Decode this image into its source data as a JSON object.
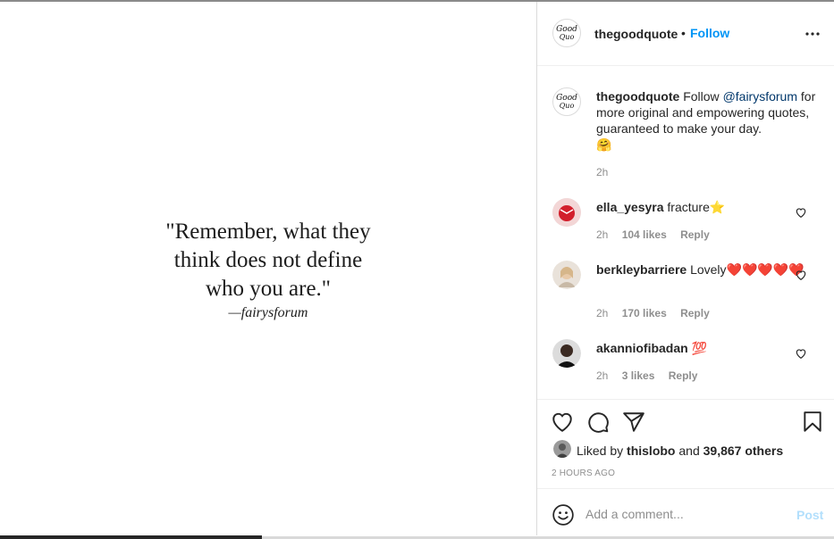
{
  "post": {
    "quote_line1": "\"Remember, what they",
    "quote_line2": "think does not define",
    "quote_line3": "who you are.\"",
    "quote_attribution": "—fairysforum"
  },
  "header": {
    "username": "thegoodquote",
    "separator": "•",
    "follow_label": "Follow"
  },
  "caption": {
    "username": "thegoodquote",
    "text_before": "Follow",
    "mention": "@fairysforum",
    "text_after": "for more original and empowering quotes, guaranteed to make your day.",
    "emoji": "🤗",
    "time": "2h"
  },
  "comments": [
    {
      "username": "ella_yesyra",
      "text": "fracture",
      "emoji": "⭐",
      "time": "2h",
      "likes": "104 likes",
      "reply": "Reply"
    },
    {
      "username": "berkleybarriere",
      "text": "Lovely",
      "emoji": "❤️❤️❤️❤️❤️",
      "time": "2h",
      "likes": "170 likes",
      "reply": "Reply"
    },
    {
      "username": "akanniofibadan",
      "text": "",
      "emoji": "💯",
      "time": "2h",
      "likes": "3 likes",
      "reply": "Reply"
    }
  ],
  "likes": {
    "prefix": "Liked by",
    "user": "thislobo",
    "conj": "and",
    "others": "39,867 others"
  },
  "timestamp": "2 hours ago",
  "compose": {
    "placeholder": "Add a comment...",
    "post_label": "Post"
  },
  "icons": {
    "more": "more-options-icon",
    "heart": "heart-icon",
    "comment": "comment-icon",
    "share": "share-icon",
    "save": "bookmark-icon",
    "emoji": "emoji-icon"
  },
  "colors": {
    "link": "#0095f6",
    "mention": "#00376b",
    "muted": "#8e8e8e",
    "post_disabled": "#b2dffc"
  }
}
